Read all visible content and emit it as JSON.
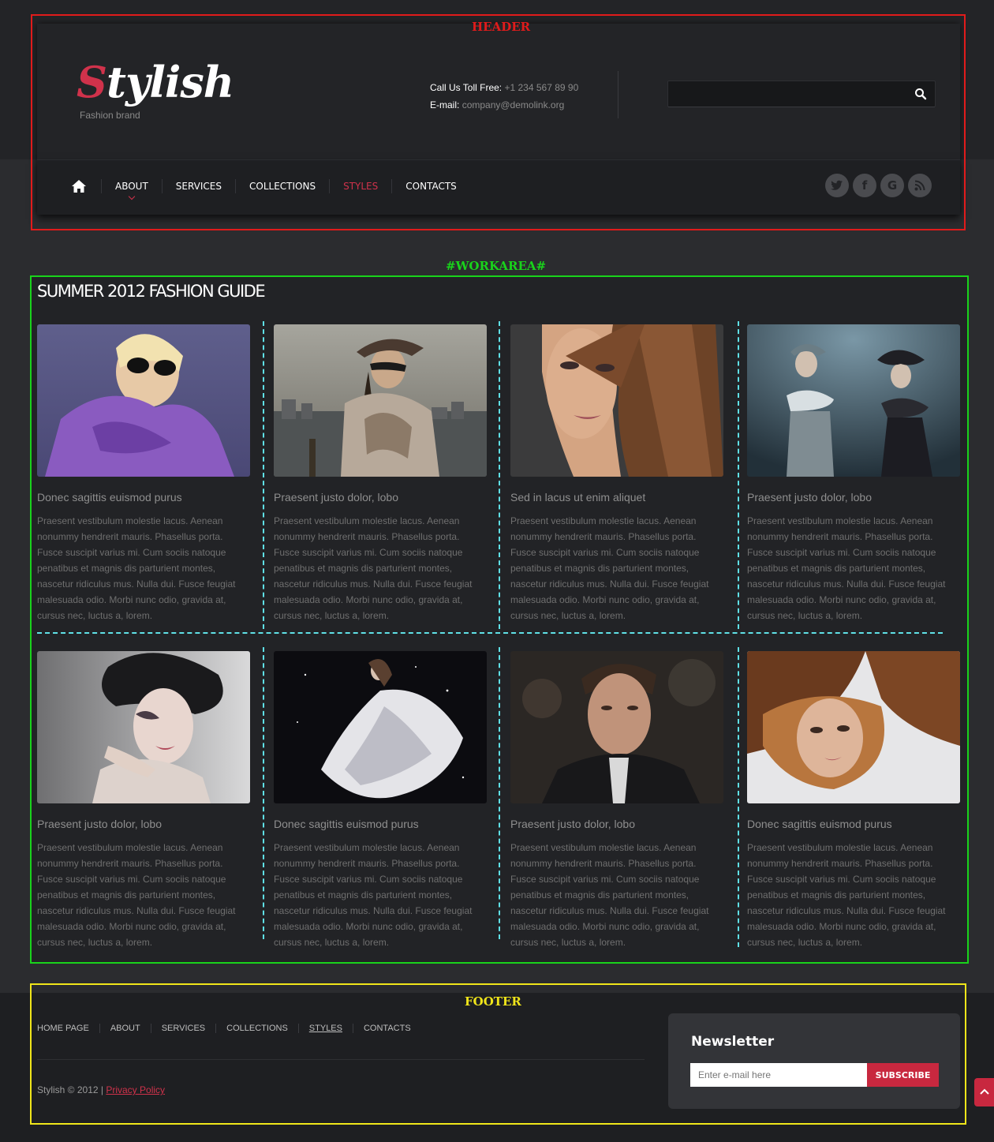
{
  "annotations": {
    "header": "HEADER",
    "workarea": "#WORKAREA#",
    "footer": "FOOTER"
  },
  "header": {
    "logo_first": "S",
    "logo_rest": "tylish",
    "tagline": "Fashion brand",
    "contact": {
      "phone_label": "Call Us Toll Free:",
      "phone": "+1 234 567 89 90",
      "email_label": "E-mail:",
      "email": "company@demolink.org"
    },
    "search": {
      "value": "",
      "placeholder": ""
    },
    "nav": [
      {
        "label": "ABOUT",
        "active": false
      },
      {
        "label": "SERVICES",
        "active": false
      },
      {
        "label": "COLLECTIONS",
        "active": false
      },
      {
        "label": "STYLES",
        "active": true
      },
      {
        "label": "CONTACTS",
        "active": false
      }
    ],
    "social": [
      "twitter-icon",
      "facebook-icon",
      "google-icon",
      "rss-icon"
    ]
  },
  "workarea": {
    "title": "SUMMER 2012 FASHION GUIDE",
    "cards": [
      {
        "title": "Donec sagittis euismod purus",
        "body": "Praesent vestibulum molestie lacus. Aenean nonummy hendrerit mauris. Phasellus porta. Fusce suscipit varius mi. Cum sociis natoque penatibus et magnis dis parturient montes, nascetur ridiculus mus. Nulla dui. Fusce feugiat malesuada odio. Morbi nunc odio, gravida at, cursus nec, luctus a, lorem."
      },
      {
        "title": "Praesent justo dolor, lobo",
        "body": "Praesent vestibulum molestie lacus. Aenean nonummy hendrerit mauris. Phasellus porta. Fusce suscipit varius mi. Cum sociis natoque penatibus et magnis dis parturient montes, nascetur ridiculus mus. Nulla dui. Fusce feugiat malesuada odio. Morbi nunc odio, gravida at, cursus nec, luctus a, lorem."
      },
      {
        "title": "Sed in lacus ut enim aliquet",
        "body": "Praesent vestibulum molestie lacus. Aenean nonummy hendrerit mauris. Phasellus porta. Fusce suscipit varius mi. Cum sociis natoque penatibus et magnis dis parturient montes, nascetur ridiculus mus. Nulla dui. Fusce feugiat malesuada odio. Morbi nunc odio, gravida at, cursus nec, luctus a, lorem."
      },
      {
        "title": "Praesent justo dolor, lobo",
        "body": "Praesent vestibulum molestie lacus. Aenean nonummy hendrerit mauris. Phasellus porta. Fusce suscipit varius mi. Cum sociis natoque penatibus et magnis dis parturient montes, nascetur ridiculus mus. Nulla dui. Fusce feugiat malesuada odio. Morbi nunc odio, gravida at, cursus nec, luctus a, lorem."
      },
      {
        "title": "Praesent justo dolor, lobo",
        "body": "Praesent vestibulum molestie lacus. Aenean nonummy hendrerit mauris. Phasellus porta. Fusce suscipit varius mi. Cum sociis natoque penatibus et magnis dis parturient montes, nascetur ridiculus mus. Nulla dui. Fusce feugiat malesuada odio. Morbi nunc odio, gravida at, cursus nec, luctus a, lorem."
      },
      {
        "title": "Donec sagittis euismod purus",
        "body": "Praesent vestibulum molestie lacus. Aenean nonummy hendrerit mauris. Phasellus porta. Fusce suscipit varius mi. Cum sociis natoque penatibus et magnis dis parturient montes, nascetur ridiculus mus. Nulla dui. Fusce feugiat malesuada odio. Morbi nunc odio, gravida at, cursus nec, luctus a, lorem."
      },
      {
        "title": "Praesent justo dolor, lobo",
        "body": "Praesent vestibulum molestie lacus. Aenean nonummy hendrerit mauris. Phasellus porta. Fusce suscipit varius mi. Cum sociis natoque penatibus et magnis dis parturient montes, nascetur ridiculus mus. Nulla dui. Fusce feugiat malesuada odio. Morbi nunc odio, gravida at, cursus nec, luctus a, lorem."
      },
      {
        "title": "Donec sagittis euismod purus",
        "body": "Praesent vestibulum molestie lacus. Aenean nonummy hendrerit mauris. Phasellus porta. Fusce suscipit varius mi. Cum sociis natoque penatibus et magnis dis parturient montes, nascetur ridiculus mus. Nulla dui. Fusce feugiat malesuada odio. Morbi nunc odio, gravida at, cursus nec, luctus a, lorem."
      }
    ]
  },
  "footer": {
    "nav": [
      "HOME PAGE",
      "ABOUT",
      "SERVICES",
      "COLLECTIONS",
      "STYLES",
      "CONTACTS"
    ],
    "copyright": "Stylish © 2012 |",
    "privacy": "Privacy Policy",
    "newsletter": {
      "title": "Newsletter",
      "placeholder": "Enter e-mail here",
      "button": "SUBSCRIBE"
    }
  },
  "colors": {
    "accent": "#d0324b",
    "background": "#2b2c2f",
    "annotation_header": "#e11b1b",
    "annotation_workarea": "#19d31b",
    "annotation_footer": "#f0e51a"
  }
}
